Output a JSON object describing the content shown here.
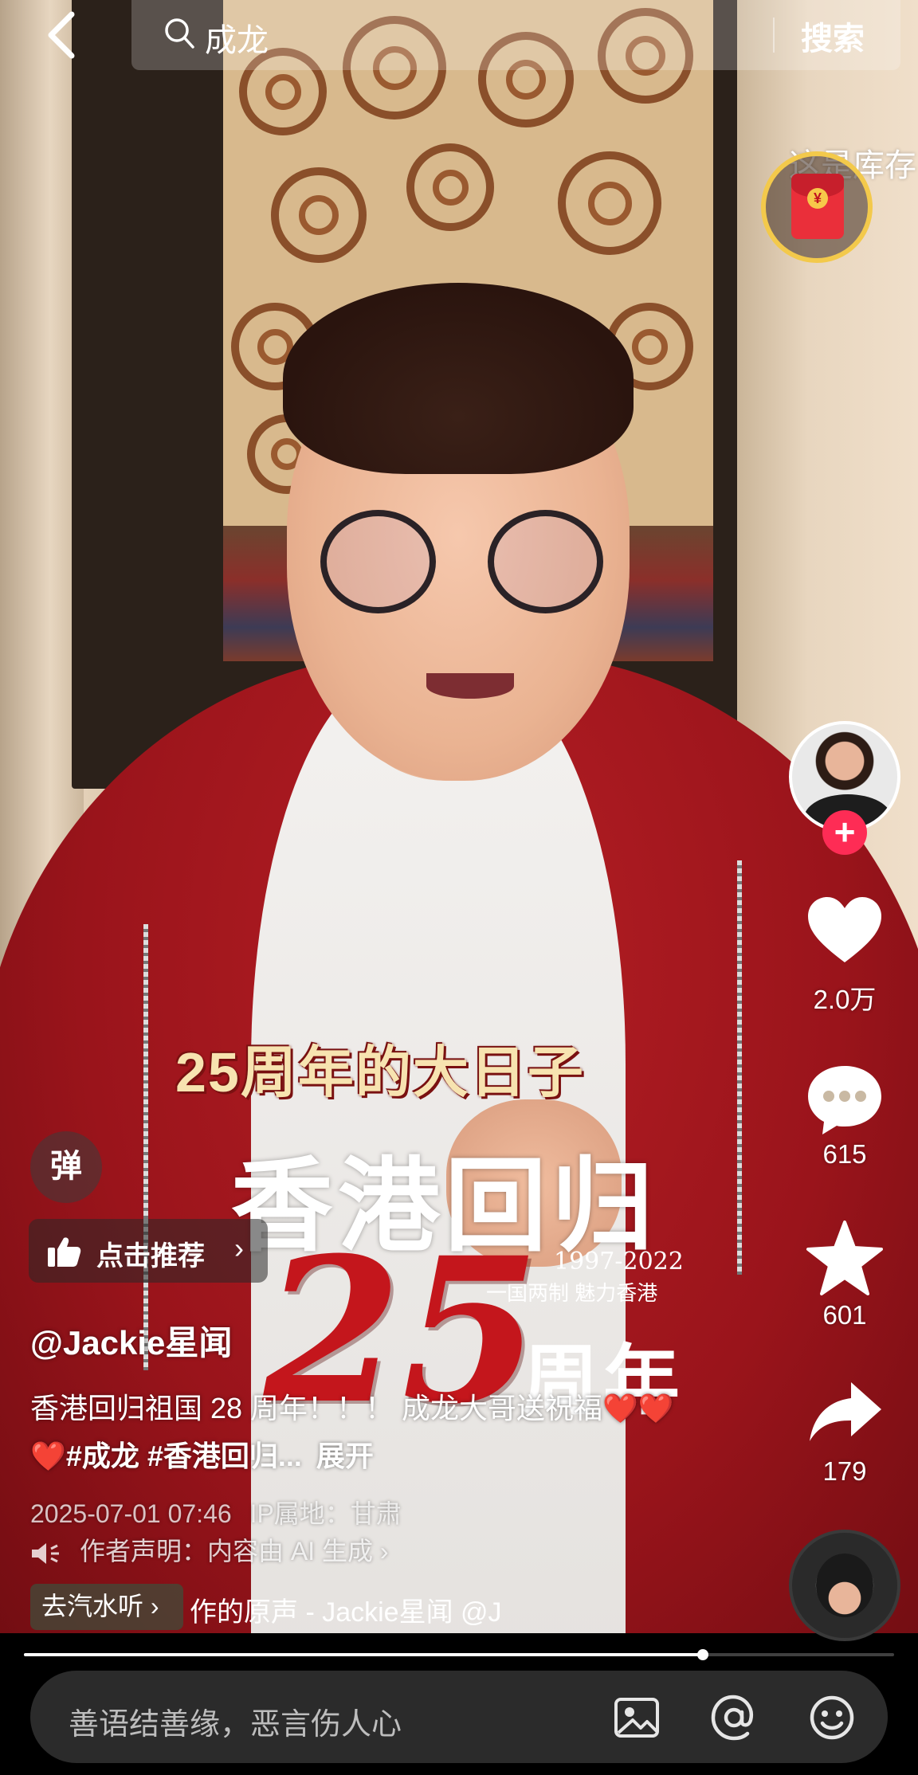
{
  "search": {
    "query": "成龙",
    "button_label": "搜索"
  },
  "marquee_text": "这是库存",
  "redpacket": {
    "coin_symbol": "¥"
  },
  "poster": {
    "title": "25周年的大日子",
    "headline": "香港回归",
    "years": "1997-2022",
    "motto": "一国两制 魅力香港",
    "number": "25",
    "anniversary": "周年"
  },
  "actions": {
    "follow_symbol": "+",
    "likes": "2.0万",
    "comments": "615",
    "favorites": "601",
    "shares": "179"
  },
  "danmu_label": "弹",
  "recommend": {
    "label": "点击推荐",
    "chevron": "›"
  },
  "post": {
    "author": "@Jackie星闻",
    "description": "香港回归祖国 28 周年！！！ 成龙大哥送祝福",
    "hearts": "❤️❤️❤️",
    "tags": "#成龙 #香港回归...",
    "expand": "展开",
    "datetime": "2025-07-01 07:46",
    "location": "IP属地：甘肃",
    "declaration": "作者声明：内容由 AI 生成 ›"
  },
  "music": {
    "chip": "去汽水听 ›",
    "title": "作的原声 - Jackie星闻    @J"
  },
  "progress": {
    "fraction": 0.78
  },
  "comment": {
    "placeholder": "善语结善缘，恶言伤人心"
  },
  "colors": {
    "accent": "#fe2c55",
    "poster_red": "#c4161c",
    "gold": "#f3c94b"
  }
}
